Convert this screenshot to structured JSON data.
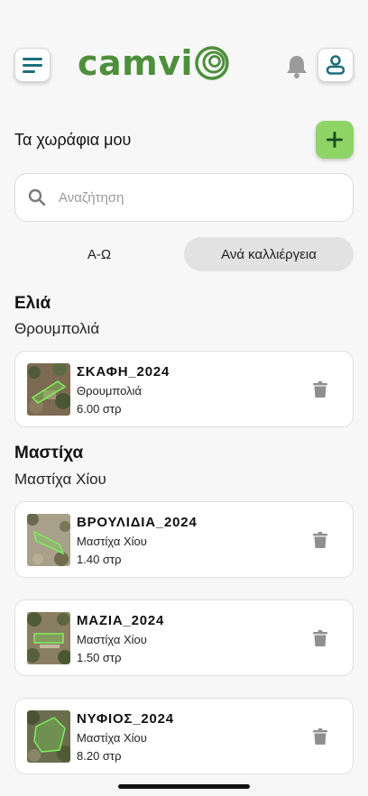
{
  "app": {
    "logo_text": "camvi",
    "brand_color": "#4e8f3c",
    "accent_color": "#8ed466"
  },
  "header": {
    "menu_icon": "hamburger-menu-icon",
    "notification_icon": "bell-icon",
    "profile_icon": "user-icon"
  },
  "page": {
    "title": "Τα χωράφια μου",
    "add_icon": "plus-icon"
  },
  "search": {
    "placeholder": "Αναζήτηση",
    "value": ""
  },
  "sort": {
    "options": [
      "Α-Ω",
      "Ανά καλλιέργεια"
    ],
    "selected": "Ανά καλλιέργεια"
  },
  "groups": [
    {
      "crop": "Ελιά",
      "variety": "Θρουμπολιά",
      "fields": [
        {
          "name": "ΣΚΑΦΗ_2024",
          "variety": "Θρουμπολιά",
          "area": "6.00 στρ"
        }
      ]
    },
    {
      "crop": "Μαστίχα",
      "variety": "Μαστίχα Χίου",
      "fields": [
        {
          "name": "ΒΡΟΥΛΙΔΙΑ_2024",
          "variety": "Μαστίχα Χίου",
          "area": "1.40 στρ"
        },
        {
          "name": "ΜΑΖΙΑ_2024",
          "variety": "Μαστίχα Χίου",
          "area": "1.50 στρ"
        },
        {
          "name": "ΝΥΦΙΟΣ_2024",
          "variety": "Μαστίχα Χίου",
          "area": "8.20 στρ"
        }
      ]
    }
  ]
}
